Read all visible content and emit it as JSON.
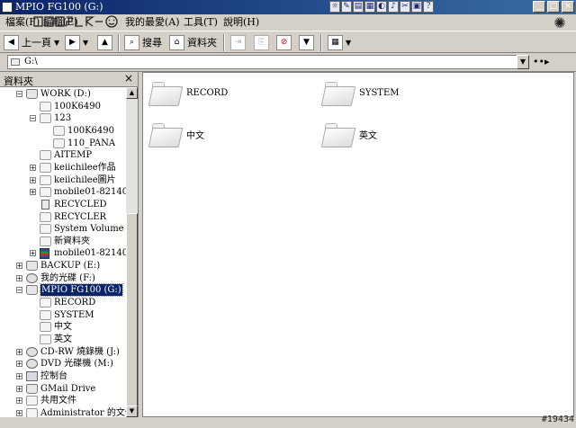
{
  "window": {
    "title": "MPIO FG100 (G:)"
  },
  "menubar": {
    "file": "檔案(F)",
    "edit": "編輯(E)",
    "favorites": "我的最愛(A)",
    "tools": "工具(T)",
    "help": "說明(H)"
  },
  "toolbar": {
    "back_label": "上一頁",
    "search_label": "搜尋",
    "folders_label": "資料夾"
  },
  "address": {
    "value": "G:\\"
  },
  "folder_pane": {
    "title": "資料夾",
    "close_glyph": "×"
  },
  "tree": [
    {
      "label": "WORK (D:)",
      "level": 1,
      "expander": "−",
      "icon": "drive"
    },
    {
      "label": "100K6490",
      "level": 2,
      "expander": "",
      "icon": "folder"
    },
    {
      "label": "123",
      "level": 2,
      "expander": "−",
      "icon": "folder"
    },
    {
      "label": "100K6490",
      "level": 3,
      "expander": "",
      "icon": "folder"
    },
    {
      "label": "110_PANA",
      "level": 3,
      "expander": "",
      "icon": "folder"
    },
    {
      "label": "AITEMP",
      "level": 2,
      "expander": "",
      "icon": "folder"
    },
    {
      "label": "keiichilee作品",
      "level": 2,
      "expander": "+",
      "icon": "folder"
    },
    {
      "label": "keiichilee圖片",
      "level": 2,
      "expander": "+",
      "icon": "folder"
    },
    {
      "label": "mobile01-82140e7d1",
      "level": 2,
      "expander": "+",
      "icon": "folder"
    },
    {
      "label": "RECYCLED",
      "level": 2,
      "expander": "",
      "icon": "bin"
    },
    {
      "label": "RECYCLER",
      "level": 2,
      "expander": "",
      "icon": "folder"
    },
    {
      "label": "System Volume Infor",
      "level": 2,
      "expander": "",
      "icon": "folder"
    },
    {
      "label": "新資料夾",
      "level": 2,
      "expander": "",
      "icon": "folder"
    },
    {
      "label": "mobile01-82140e7d1",
      "level": 2,
      "expander": "+",
      "icon": "stack"
    },
    {
      "label": "BACKUP (E:)",
      "level": 1,
      "expander": "+",
      "icon": "drive"
    },
    {
      "label": "我的光碟 (F:)",
      "level": 1,
      "expander": "+",
      "icon": "cd"
    },
    {
      "label": "MPIO FG100 (G:)",
      "level": 1,
      "expander": "−",
      "icon": "drive",
      "selected": true
    },
    {
      "label": "RECORD",
      "level": 2,
      "expander": "",
      "icon": "folder"
    },
    {
      "label": "SYSTEM",
      "level": 2,
      "expander": "",
      "icon": "folder"
    },
    {
      "label": "中文",
      "level": 2,
      "expander": "",
      "icon": "folder"
    },
    {
      "label": "英文",
      "level": 2,
      "expander": "",
      "icon": "folder"
    },
    {
      "label": "CD-RW 燒錄機 (J:)",
      "level": 1,
      "expander": "+",
      "icon": "cd"
    },
    {
      "label": "DVD 光碟機 (M:)",
      "level": 1,
      "expander": "+",
      "icon": "cd"
    },
    {
      "label": "控制台",
      "level": 1,
      "expander": "+",
      "icon": "cp"
    },
    {
      "label": "GMail Drive",
      "level": 1,
      "expander": "+",
      "icon": "drive"
    },
    {
      "label": "共用文件",
      "level": 1,
      "expander": "+",
      "icon": "folder"
    },
    {
      "label": "Administrator 的文件",
      "level": 1,
      "expander": "+",
      "icon": "folder"
    }
  ],
  "files": [
    {
      "name": "RECORD"
    },
    {
      "name": "SYSTEM"
    },
    {
      "name": "中文"
    },
    {
      "name": "英文"
    }
  ],
  "watermark": "#19434"
}
